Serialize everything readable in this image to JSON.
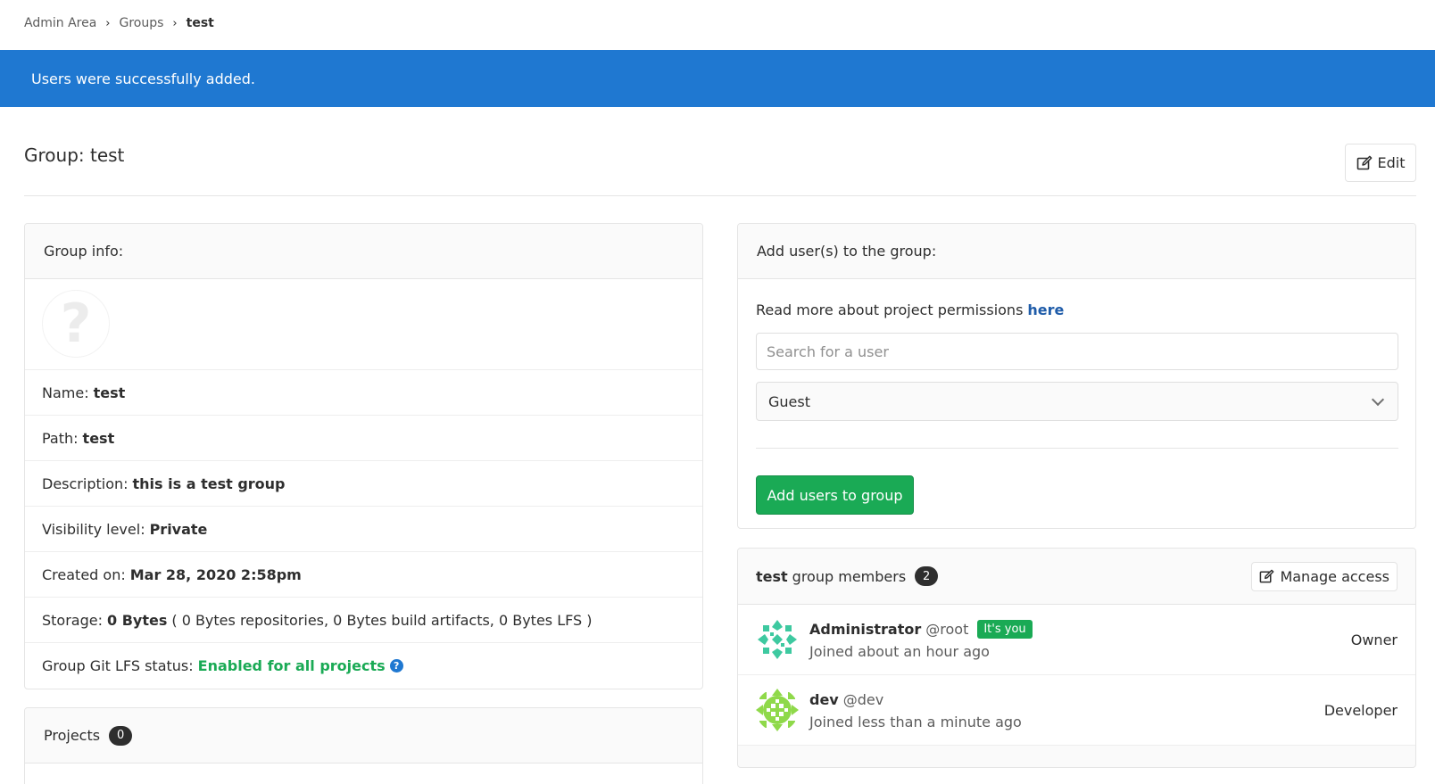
{
  "breadcrumb": {
    "items": [
      "Admin Area",
      "Groups",
      "test"
    ]
  },
  "flash": {
    "message": "Users were successfully added."
  },
  "header": {
    "title": "Group: test",
    "edit_label": "Edit"
  },
  "group_info": {
    "title": "Group info:",
    "avatar_glyph": "?",
    "name_label": "Name:",
    "name": "test",
    "path_label": "Path:",
    "path": "test",
    "description_label": "Description:",
    "description": "this is a test group",
    "visibility_label": "Visibility level:",
    "visibility": "Private",
    "created_label": "Created on:",
    "created": "Mar 28, 2020 2:58pm",
    "storage_label": "Storage:",
    "storage_total": "0 Bytes",
    "storage_detail": "( 0 Bytes repositories, 0 Bytes build artifacts, 0 Bytes LFS )",
    "lfs_label": "Group Git LFS status:",
    "lfs_status": "Enabled for all projects",
    "help_glyph": "?"
  },
  "projects": {
    "title": "Projects",
    "count": "0"
  },
  "add_users": {
    "title": "Add user(s) to the group:",
    "permissions_text": "Read more about project permissions",
    "permissions_link": "here",
    "search_placeholder": "Search for a user",
    "role_selected": "Guest",
    "submit_label": "Add users to group"
  },
  "members": {
    "group_name": "test",
    "title_suffix": "group members",
    "count": "2",
    "manage_label": "Manage access",
    "list": [
      {
        "name": "Administrator",
        "handle": "@root",
        "badge": "It's you",
        "joined": "Joined about an hour ago",
        "role": "Owner"
      },
      {
        "name": "dev",
        "handle": "@dev",
        "joined": "Joined less than a minute ago",
        "role": "Developer"
      }
    ]
  },
  "colors": {
    "accent": "#1f78d1",
    "success": "#1aaa55",
    "link": "#1f5ca9"
  }
}
